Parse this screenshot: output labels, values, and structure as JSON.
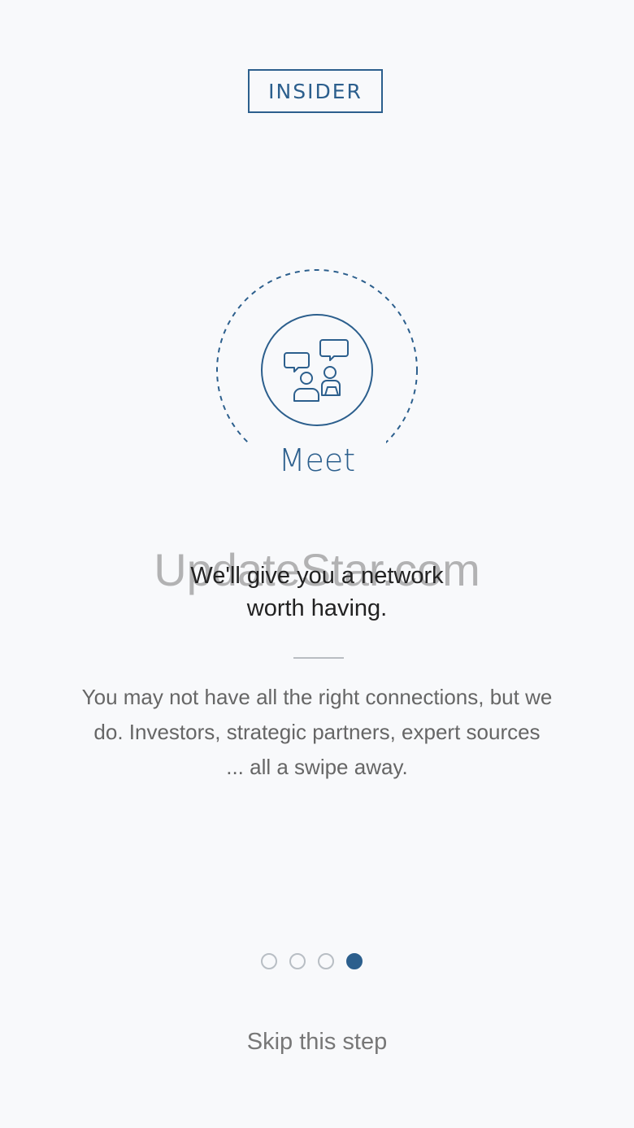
{
  "brand": {
    "logo_text": "INSIDER"
  },
  "hero": {
    "icon": "chat-people-icon",
    "label": "Meet"
  },
  "watermark": {
    "text": "UpdateStar.com"
  },
  "content": {
    "headline_line1": "We'll give you a network",
    "headline_line2": "worth having.",
    "body_line1": "You may not have all the right connections, but we",
    "body_line2": "do. Investors, strategic partners, expert sources",
    "body_line3": "... all a swipe away."
  },
  "pagination": {
    "total": 4,
    "current": 4
  },
  "footer": {
    "skip_label": "Skip this step"
  },
  "colors": {
    "accent": "#2c5f8d",
    "background": "#f8f9fb",
    "text_primary": "#222222",
    "text_secondary": "#666666"
  }
}
